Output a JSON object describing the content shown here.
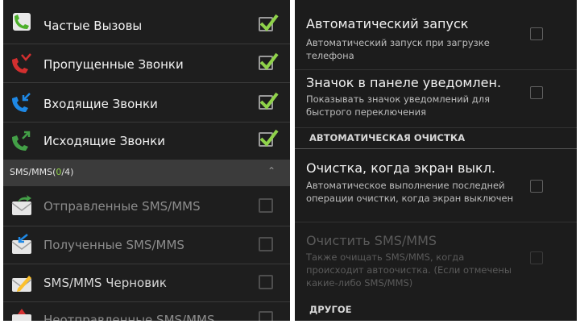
{
  "call_log": {
    "items": [
      {
        "label": "Частые Вызовы",
        "icon": "frequent-calls-icon",
        "checked": true
      },
      {
        "label": "Пропущенные Звонки",
        "icon": "missed-call-icon",
        "checked": true
      },
      {
        "label": "Входящие Звонки",
        "icon": "incoming-call-icon",
        "checked": true
      },
      {
        "label": "Исходящие Звонки",
        "icon": "outgoing-call-icon",
        "checked": true
      }
    ]
  },
  "sms_section": {
    "title_prefix": "SMS/MMS(",
    "count_selected": "0",
    "title_suffix": "/4)",
    "items": [
      {
        "label": "Отправленные SMS/MMS",
        "icon": "sent-sms-icon",
        "checked": false
      },
      {
        "label": "Полученные SMS/MMS",
        "icon": "received-sms-icon",
        "checked": false
      },
      {
        "label": "SMS/MMS Черновик",
        "icon": "draft-sms-icon",
        "checked": false
      },
      {
        "label": "Неотправленные SMS/MMS",
        "icon": "unsent-sms-icon",
        "checked": false
      }
    ]
  },
  "settings": {
    "auto_start": {
      "title": "Автоматический запуск",
      "summary": "Автоматический запуск при загрузке телефона",
      "checked": false
    },
    "notification_icon": {
      "title": "Значок в панеле уведомлен.",
      "summary": "Показывать значок уведомлений для быстрого переключения",
      "checked": false
    },
    "auto_clean_header": "АВТОМАТИЧЕСКАЯ ОЧИСТКА",
    "clean_screen_off": {
      "title": "Очистка, когда экран выкл.",
      "summary": "Автоматическое выполнение последней операции очистки, когда экран выключен",
      "checked": false
    },
    "clean_sms": {
      "title": "Очистить SMS/MMS",
      "summary": "Также очищать SMS/MMS, когда происходит автоочистка. (Если отмечены какие-либо SMS/MMS)",
      "checked": false,
      "disabled": true
    },
    "other_header": "ДРУГОЕ"
  },
  "colors": {
    "accent_green": "#8fd24a",
    "background": "#1e1e1e",
    "section_bar": "#3b3b3b"
  }
}
